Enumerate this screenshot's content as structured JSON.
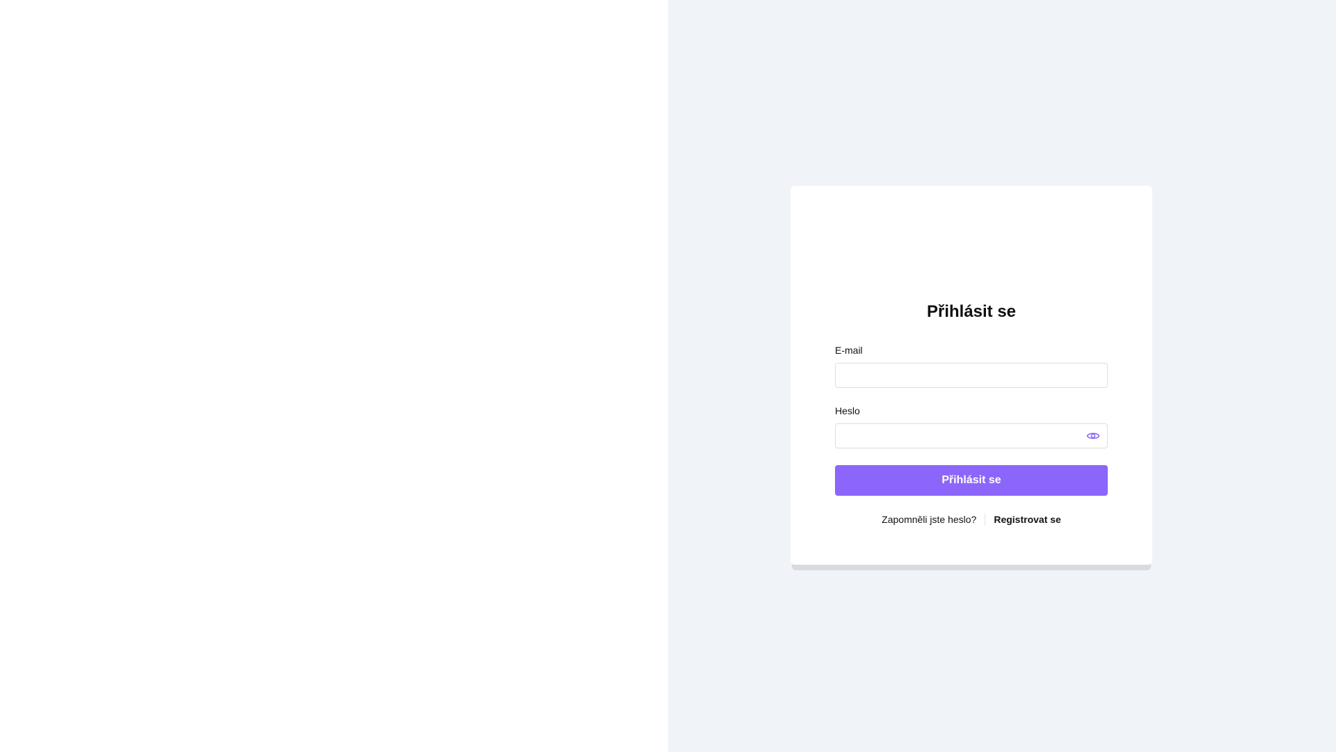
{
  "login": {
    "title": "Přihlásit se",
    "email": {
      "label": "E-mail",
      "value": "",
      "placeholder": ""
    },
    "password": {
      "label": "Heslo",
      "value": "",
      "placeholder": "",
      "toggle_icon": "eye-icon"
    },
    "submit_label": "Přihlásit se",
    "forgot_password_label": "Zapomněli jste heslo?",
    "register_label": "Registrovat se"
  },
  "colors": {
    "accent": "#8c66fb",
    "left_background": "#ffffff",
    "right_background": "#f0f3f8",
    "card": "#ffffff"
  }
}
